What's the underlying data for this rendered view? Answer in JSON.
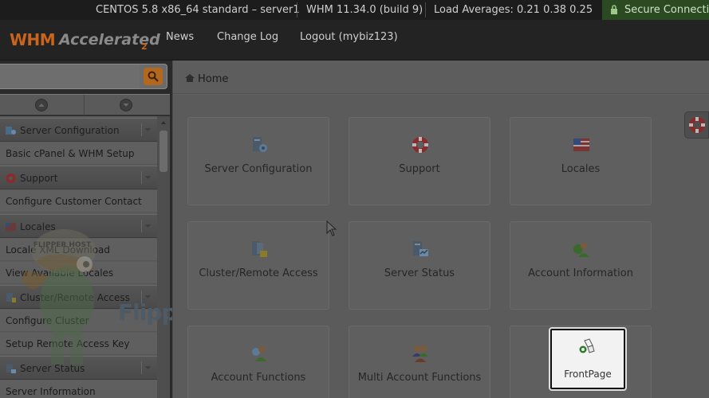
{
  "statusbar": {
    "os": "CENTOS 5.8 x86_64 standard – server1",
    "version": "WHM 11.34.0 (build 9)",
    "load": "Load Averages: 0.21 0.38 0.25",
    "secure": "Secure Connection"
  },
  "header": {
    "logo_whm": "WHM",
    "logo_accelerated": "Accelerated",
    "logo_two": "2",
    "nav": [
      "News",
      "Change Log",
      "Logout (mybiz123)"
    ]
  },
  "search": {
    "value": "",
    "placeholder": ""
  },
  "sidebar": {
    "items": [
      {
        "type": "category",
        "label": "Server Configuration",
        "icon": "server-config-icon"
      },
      {
        "type": "link",
        "label": "Basic cPanel & WHM Setup"
      },
      {
        "type": "category",
        "label": "Support",
        "icon": "lifebuoy-icon"
      },
      {
        "type": "link",
        "label": "Configure Customer Contact"
      },
      {
        "type": "category",
        "label": "Locales",
        "icon": "flag-icon"
      },
      {
        "type": "link",
        "label": "Locale XML Download"
      },
      {
        "type": "link",
        "label": "View Available Locales"
      },
      {
        "type": "category",
        "label": "Cluster/Remote Access",
        "icon": "cluster-icon"
      },
      {
        "type": "link",
        "label": "Configure Cluster"
      },
      {
        "type": "link",
        "label": "Setup Remote Access Key"
      },
      {
        "type": "category",
        "label": "Server Status",
        "icon": "server-status-icon"
      },
      {
        "type": "link",
        "label": "Server Information"
      }
    ]
  },
  "breadcrumb": {
    "home": "Home"
  },
  "tiles": [
    {
      "label": "Server Configuration",
      "icon": "server-config-icon"
    },
    {
      "label": "Support",
      "icon": "lifebuoy-icon"
    },
    {
      "label": "Locales",
      "icon": "flag-icon"
    },
    {
      "label": "Cluster/Remote Access",
      "icon": "cluster-icon"
    },
    {
      "label": "Server Status",
      "icon": "server-status-icon"
    },
    {
      "label": "Account Information",
      "icon": "account-info-icon"
    },
    {
      "label": "Account Functions",
      "icon": "account-functions-icon"
    },
    {
      "label": "Multi Account Functions",
      "icon": "multi-account-icon"
    }
  ],
  "highlight": {
    "label": "FrontPage",
    "icon": "frontpage-icon"
  },
  "watermark": {
    "text": "FlipperHost",
    "badge": "FLIPPER HOST"
  },
  "colors": {
    "accent": "#c8641c",
    "secure_bg": "#2b4a22",
    "search_btn": "#b4681e"
  }
}
